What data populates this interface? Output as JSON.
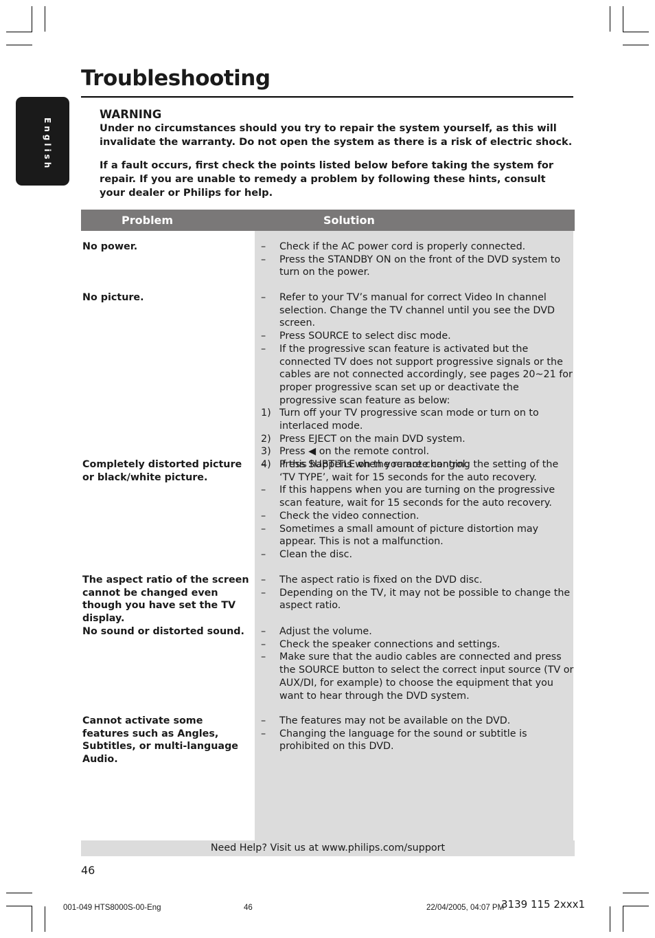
{
  "page": {
    "title": "Troubleshooting",
    "language_tab": "English",
    "warning": {
      "heading": "WARNING",
      "text1": "Under no circumstances should you try to repair the system yourself, as this will invalidate the warranty.  Do not open the system as there is a risk of electric shock.",
      "text2": "If a fault occurs, first check the points listed below before taking the system for repair. If you are unable to remedy a problem by following these hints, consult your dealer or Philips for help."
    },
    "table": {
      "headers": [
        "Problem",
        "Solution"
      ],
      "rows": [
        {
          "problem": "No power.",
          "solutions": [
            {
              "marker": "–",
              "text": "Check if the AC power cord is properly connected."
            },
            {
              "marker": "–",
              "text": "Press the STANDBY ON on the front of the DVD system to turn on the power."
            }
          ]
        },
        {
          "problem": "No picture.",
          "solutions": [
            {
              "marker": "–",
              "text": "Refer to your TV’s manual for correct Video In channel selection. Change the TV channel until you see the DVD screen."
            },
            {
              "marker": "–",
              "text": "Press SOURCE to select disc mode."
            },
            {
              "marker": "–",
              "text": "If the progressive scan feature is activated but the connected TV does not support progressive signals or the cables are not connected accordingly, see pages 20~21 for proper progressive scan set up or deactivate the progressive scan feature as below:"
            },
            {
              "marker": "1)",
              "text": "Turn off your TV progressive scan mode or turn on to interlaced mode."
            },
            {
              "marker": "2)",
              "text": "Press EJECT on the main DVD system."
            },
            {
              "marker": "3)",
              "text": "Press ◀ on the remote control."
            },
            {
              "marker": "4)",
              "text": "Press SUBTITLE on the remote control."
            }
          ]
        },
        {
          "problem": "Completely distorted picture or black/white picture.",
          "solutions": [
            {
              "marker": "–",
              "text": "If this happens when you are changing the setting of the ‘TV TYPE’, wait for 15 seconds for the auto recovery."
            },
            {
              "marker": "–",
              "text": "If this happens when you are turning on the progressive scan feature, wait for 15 seconds for the auto recovery."
            },
            {
              "marker": "–",
              "text": "Check the video connection."
            },
            {
              "marker": "–",
              "text": "Sometimes a small amount of picture distortion may appear. This is not a malfunction."
            },
            {
              "marker": "–",
              "text": "Clean the disc."
            }
          ]
        },
        {
          "problem": "The aspect ratio of the screen cannot be changed even though you have set the TV display.",
          "solutions": [
            {
              "marker": "–",
              "text": "The aspect ratio is fixed on the DVD disc."
            },
            {
              "marker": "–",
              "text": "Depending on the TV, it may not be possible to change the aspect ratio."
            }
          ]
        },
        {
          "problem": "No sound or distorted sound.",
          "solutions": [
            {
              "marker": "–",
              "text": "Adjust the volume."
            },
            {
              "marker": "–",
              "text": "Check the speaker connections and settings."
            },
            {
              "marker": "–",
              "text": "Make sure that the audio cables are connected and press the SOURCE button to select the correct input source (TV or AUX/DI, for example) to choose the equipment that you want to hear through the DVD system."
            }
          ]
        },
        {
          "problem": "Cannot activate some features such as Angles, Subtitles, or multi-language Audio.",
          "solutions": [
            {
              "marker": "–",
              "text": "The features may not be available on the DVD."
            },
            {
              "marker": "–",
              "text": "Changing the language for the sound or subtitle is prohibited on this DVD."
            }
          ]
        }
      ]
    },
    "help_text": "Need Help?  Visit us at www.philips.com/support",
    "page_number": "46",
    "footer": {
      "file": "001-049 HTS8000S-00-Eng",
      "page": "46",
      "datetime": "22/04/2005, 04:07 PM",
      "code": "3139 115 2xxx1"
    }
  }
}
